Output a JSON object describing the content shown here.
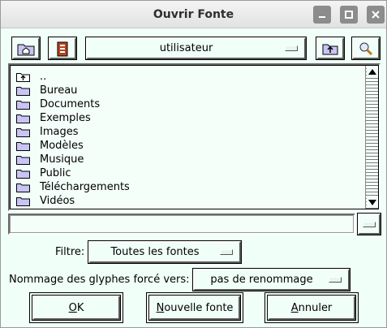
{
  "window": {
    "title": "Ouvrir Fonte"
  },
  "toolbar": {
    "directory": "utilisateur"
  },
  "file_list": {
    "items": [
      {
        "label": "..",
        "icon": "parent-folder-icon"
      },
      {
        "label": "Bureau",
        "icon": "folder-icon"
      },
      {
        "label": "Documents",
        "icon": "folder-icon"
      },
      {
        "label": "Exemples",
        "icon": "folder-icon"
      },
      {
        "label": "Images",
        "icon": "folder-icon"
      },
      {
        "label": "Modèles",
        "icon": "folder-icon"
      },
      {
        "label": "Musique",
        "icon": "folder-icon"
      },
      {
        "label": "Public",
        "icon": "folder-icon"
      },
      {
        "label": "Téléchargements",
        "icon": "folder-icon"
      },
      {
        "label": "Vidéos",
        "icon": "folder-icon"
      }
    ]
  },
  "path_input": {
    "value": ""
  },
  "filter": {
    "label": "Filtre:",
    "value": "Toutes les fontes"
  },
  "glyph_naming": {
    "label": "Nommage des glyphes forcé vers:",
    "value": "pas de renommage"
  },
  "buttons": {
    "ok_mnemonic": "O",
    "ok_rest": "K",
    "new_mnemonic": "N",
    "new_rest": "ouvelle fonte",
    "cancel_mnemonic": "A",
    "cancel_rest": "nnuler"
  },
  "colors": {
    "background": "#f0fff8",
    "titlebar": "#e6e6e6",
    "folder": "#c9c4f4"
  }
}
